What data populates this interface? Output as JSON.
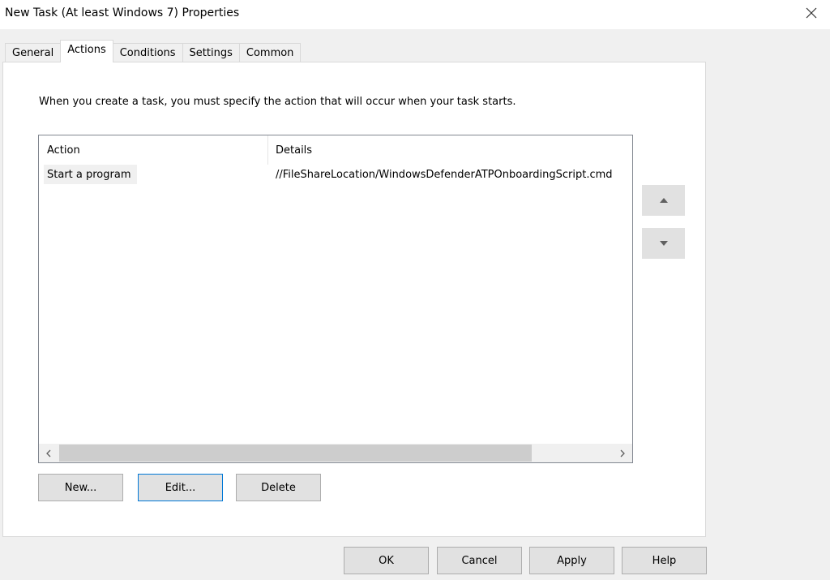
{
  "window": {
    "title": "New Task (At least Windows 7) Properties"
  },
  "tabs": [
    {
      "label": "General",
      "active": false
    },
    {
      "label": "Actions",
      "active": true
    },
    {
      "label": "Conditions",
      "active": false
    },
    {
      "label": "Settings",
      "active": false
    },
    {
      "label": "Common",
      "active": false
    }
  ],
  "panel": {
    "instruction": "When you create a task, you must specify the action that will occur when your task starts.",
    "list": {
      "columns": [
        "Action",
        "Details"
      ],
      "rows": [
        {
          "action": "Start a program",
          "details": "//FileShareLocation/WindowsDefenderATPOnboardingScript.cmd"
        }
      ]
    },
    "buttons": {
      "new": "New...",
      "edit": "Edit...",
      "delete": "Delete"
    }
  },
  "footer": {
    "ok": "OK",
    "cancel": "Cancel",
    "apply": "Apply",
    "help": "Help"
  },
  "icons": {
    "close": "close-icon",
    "move_up": "triangle-up-icon",
    "move_down": "triangle-down-icon",
    "scroll_left": "chevron-left-icon",
    "scroll_right": "chevron-right-icon"
  },
  "colors": {
    "focus_border": "#0078d7",
    "button_face": "#e1e1e1",
    "dialog_background": "#f0f0f0"
  }
}
